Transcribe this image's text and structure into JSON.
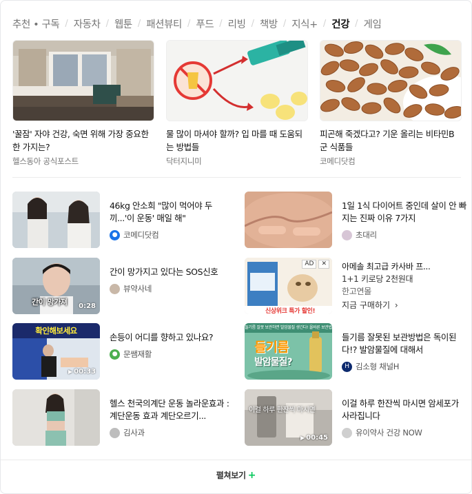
{
  "tabs": [
    {
      "label": "추천 • 구독"
    },
    {
      "label": "자동차"
    },
    {
      "label": "웹툰"
    },
    {
      "label": "패션뷰티"
    },
    {
      "label": "푸드"
    },
    {
      "label": "리빙"
    },
    {
      "label": "책방"
    },
    {
      "label": "지식+"
    },
    {
      "label": "건강",
      "active": true
    },
    {
      "label": "게임"
    }
  ],
  "featured": [
    {
      "title": "'꿀잠' 자야 건강, 숙면 위해 가장 중요한 한 가지는?",
      "source": "헬스동아 공식포스트"
    },
    {
      "title": "물 많이 마셔야 할까? 입 마를 때 도움되는 방법들",
      "source": "닥터지니미"
    },
    {
      "title": "피곤해 죽겠다고? 기운 올리는 비타민B군 식품들",
      "source": "코메디닷컴"
    }
  ],
  "left_items": [
    {
      "title": "46kg 안소희 \"많이 먹어야 두끼...'이 운동' 매일 해\"",
      "author": "코메디닷컴"
    },
    {
      "title": "간이 망가지고 있다는 SOS신호",
      "author": "뷰약사네",
      "duration": "0:28",
      "thumb_text": "간이 망가져"
    },
    {
      "title": "손등이 어디를 향하고 있나요?",
      "author": "문쌤재활",
      "duration": "00:33",
      "thumb_text": "확인해보세요"
    },
    {
      "title": "헬스 천국의계단 운동 놀라운효과 : 계단운동 효과 계단오르기...",
      "author": "김사과"
    }
  ],
  "right_items": [
    {
      "title": "1일 1식 다이어트 중인데 살이 안 빠지는 진짜 이유 7가지",
      "author": "초대리"
    },
    {
      "title": "들기름 잘못된 보관방법은 독이된다!? 발암물질에 대해서",
      "author": "김소형 채널H",
      "thumb_text": "들기름",
      "thumb_text2": "발암물질?",
      "thumb_banner": "들기름 잘못 보관하면 발암물질 생긴다! 올바른 보관법"
    },
    {
      "title": "이걸 하루 한잔씩 마시면 암세포가 사라집니다",
      "author": "유이약사 건강 NOW",
      "duration": "00:45",
      "thumb_text": "이걸 하루 한잔씩 마시면"
    }
  ],
  "ad": {
    "badge": "AD",
    "close": "✕",
    "title": "아메솔 최고급 카사바 프...",
    "subtitle": "1+1 키로당 2천원대",
    "advertiser": "한고연몰",
    "cta": "지금 구매하기",
    "thumb_text": "신상위크 특가 할인!"
  },
  "more": {
    "label": "펼쳐보기",
    "icon": "+"
  },
  "colors": {
    "accent_green": "#03c75a",
    "text_muted": "#767676"
  }
}
